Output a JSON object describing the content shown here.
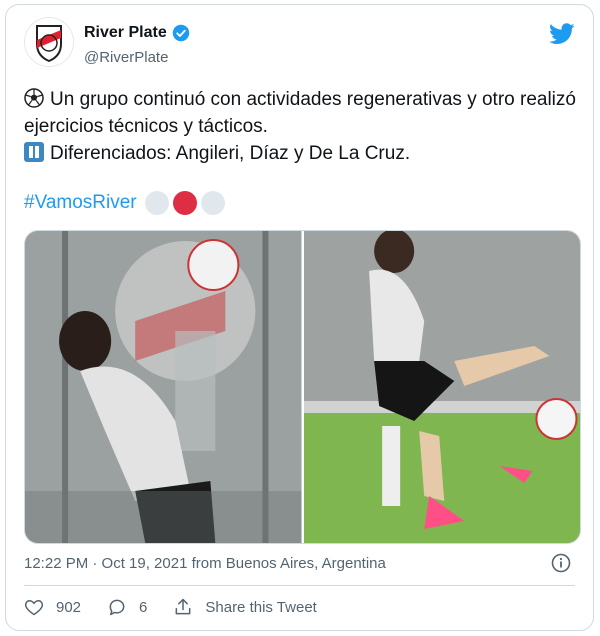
{
  "user": {
    "display_name": "River Plate",
    "handle": "@RiverPlate",
    "avatar_icon": "river-plate-crest",
    "verified_icon": "verified-badge"
  },
  "tweet": {
    "line1": "Un grupo continuó con actividades regenerativas y otro realizó ejercicios técnicos y tácticos.",
    "line2": "Diferenciados: Angileri, Díaz y De La Cruz.",
    "hashtag": "#VamosRiver",
    "emoji_1": "soccer-ball-emoji",
    "emoji_2": "pause-button-emoji"
  },
  "meta": {
    "timestamp": "12:22 PM · Oct 19, 2021 from Buenos Aires, Argentina"
  },
  "actions": {
    "likes": "902",
    "replies": "6",
    "share_label": "Share this Tweet"
  },
  "colors": {
    "accent": "#1d9bf0",
    "text": "#0f1419",
    "muted": "#536471",
    "red": "#dd2e44"
  }
}
